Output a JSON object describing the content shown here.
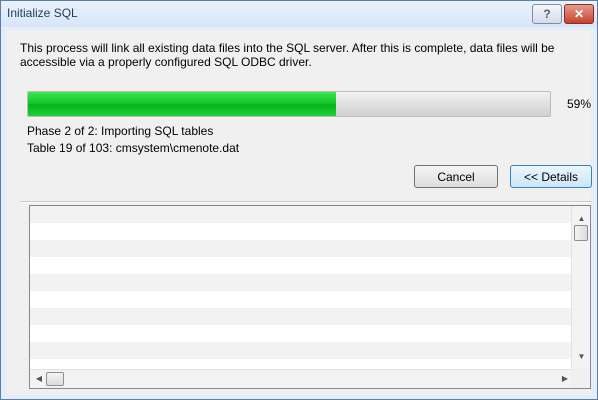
{
  "window": {
    "title": "Initialize SQL",
    "help_label": "?",
    "close_label": "✕"
  },
  "description": "This process will link all existing data files into the SQL server.  After this is complete, data files will be accessible via a properly configured SQL ODBC driver.",
  "progress": {
    "value": 0.59,
    "percent_label": "59%",
    "fill_color": "#13c72a"
  },
  "status": {
    "phase": "Phase 2 of 2: Importing SQL tables",
    "table": "Table 19 of 103: cmsystem\\cmenote.dat"
  },
  "buttons": {
    "cancel": "Cancel",
    "details": "<< Details"
  },
  "log": {
    "rows": [
      "",
      "",
      "",
      "",
      "",
      "",
      "",
      "",
      ""
    ]
  },
  "scrollbars": {
    "up": "▲",
    "down": "▼",
    "left": "◀",
    "right": "▶"
  }
}
